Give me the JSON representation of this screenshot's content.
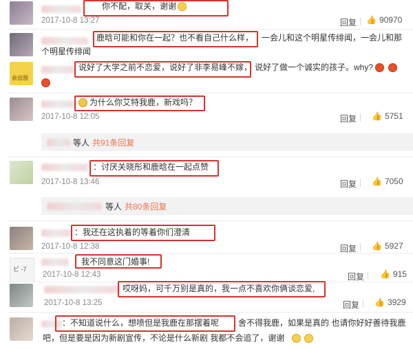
{
  "comments": [
    {
      "text_a": "你不配，取关，谢谢",
      "date": "2017-10-8 13:27",
      "reply": "回复",
      "likes": "90970"
    },
    {
      "text_a": "鹿晗可能和你在一起？也不看自己什么样，",
      "text_b": "一会儿和这个明星传绯闻，一会儿和那",
      "text_c": "个明星传绯闻"
    },
    {
      "text_a": "说好了大学之前不恋爱，说好了非李易峰不嫁，",
      "text_b": "说好了做一个诚实的孩子。why?"
    },
    {
      "text_a": "为什么你艾特我鹿，新戏吗？",
      "date": "2017-10-8 12:05",
      "reply": "回复",
      "likes": "5751",
      "sub_prefix": "等人",
      "sub_count": "共91条回复"
    },
    {
      "text_a": "：讨厌关晓彤和鹿晗在一起点赞",
      "date": "2017-10-8 13:46",
      "reply": "回复",
      "likes": "7050",
      "sub_prefix": "等人",
      "sub_count": "共80条回复"
    },
    {
      "text_a": "：我还在这执着的等着你们澄清",
      "date": "2017-10-8 12:38",
      "reply": "回复",
      "likes": "5927"
    },
    {
      "text_a": "我不同意这门婚事!",
      "date": "2017-10-8 12:43",
      "reply": "回复",
      "likes": "915"
    },
    {
      "text_a": "哎呀妈，可千万别是真的，我一点不喜欢你俩谈恋爱,",
      "date": "2017-10-8 13:25",
      "reply": "回复",
      "likes": "3929"
    },
    {
      "text_a": "：不知道说什么，想喷但是我鹿在那摆着呢",
      "text_b": "舍不得我鹿，如果是真的 也请你好好善待我鹿",
      "text_c": "吧，但是要是因为新剧宣传，不论是什么新剧 我都不会追了，谢谢"
    }
  ],
  "misc": {
    "avatar_badge": "会出圈",
    "avatar_b": "ビ -7"
  },
  "colors": {
    "highlight_box": "#d9302a",
    "link": "#eb7350",
    "date": "#888888"
  }
}
